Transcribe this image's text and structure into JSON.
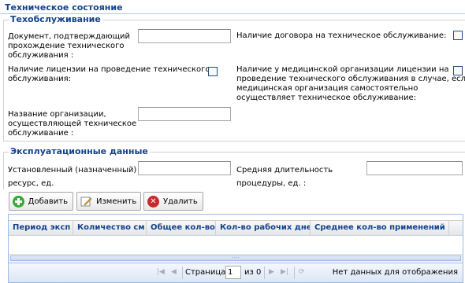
{
  "header": {
    "title": "Техническое состояние"
  },
  "maintenance": {
    "legend": "Техобслуживание",
    "doc_label": [
      "Документ, подтверждающий",
      "прохождение технического",
      "обслуживания :"
    ],
    "license_label": [
      "Наличие лицензии на проведение технического",
      "обслуживания:"
    ],
    "org_label": [
      "Название организации,",
      "осуществляющей техническое",
      "обслуживание :"
    ],
    "contract_label": "Наличие договора на техническое обслуживание:",
    "med_license_label": [
      "Наличие у медицинской организации лицензии на",
      "проведение технического обслуживания в случае, если",
      "медицинская организация самостоятельно",
      "осуществляет техническое обслуживание:"
    ]
  },
  "operation": {
    "legend": "Эксплуатационные данные",
    "resource_label": [
      "Установленный (назначенный)",
      "ресурс, ед."
    ],
    "duration_label": [
      "Средняя длительность",
      "процедуры, ед. :"
    ]
  },
  "toolbar": {
    "add": "Добавить",
    "edit": "Изменить",
    "delete": "Удалить"
  },
  "grid": {
    "columns": [
      "Период эксп",
      "Количество см",
      "Общее кол-во",
      "Кол-во рабочих дне",
      "Среднее кол-во применений в"
    ]
  },
  "pager": {
    "page_label": "Страница",
    "page_value": "1",
    "of_label": "из 0",
    "empty_text": "Нет данных для отображения"
  }
}
